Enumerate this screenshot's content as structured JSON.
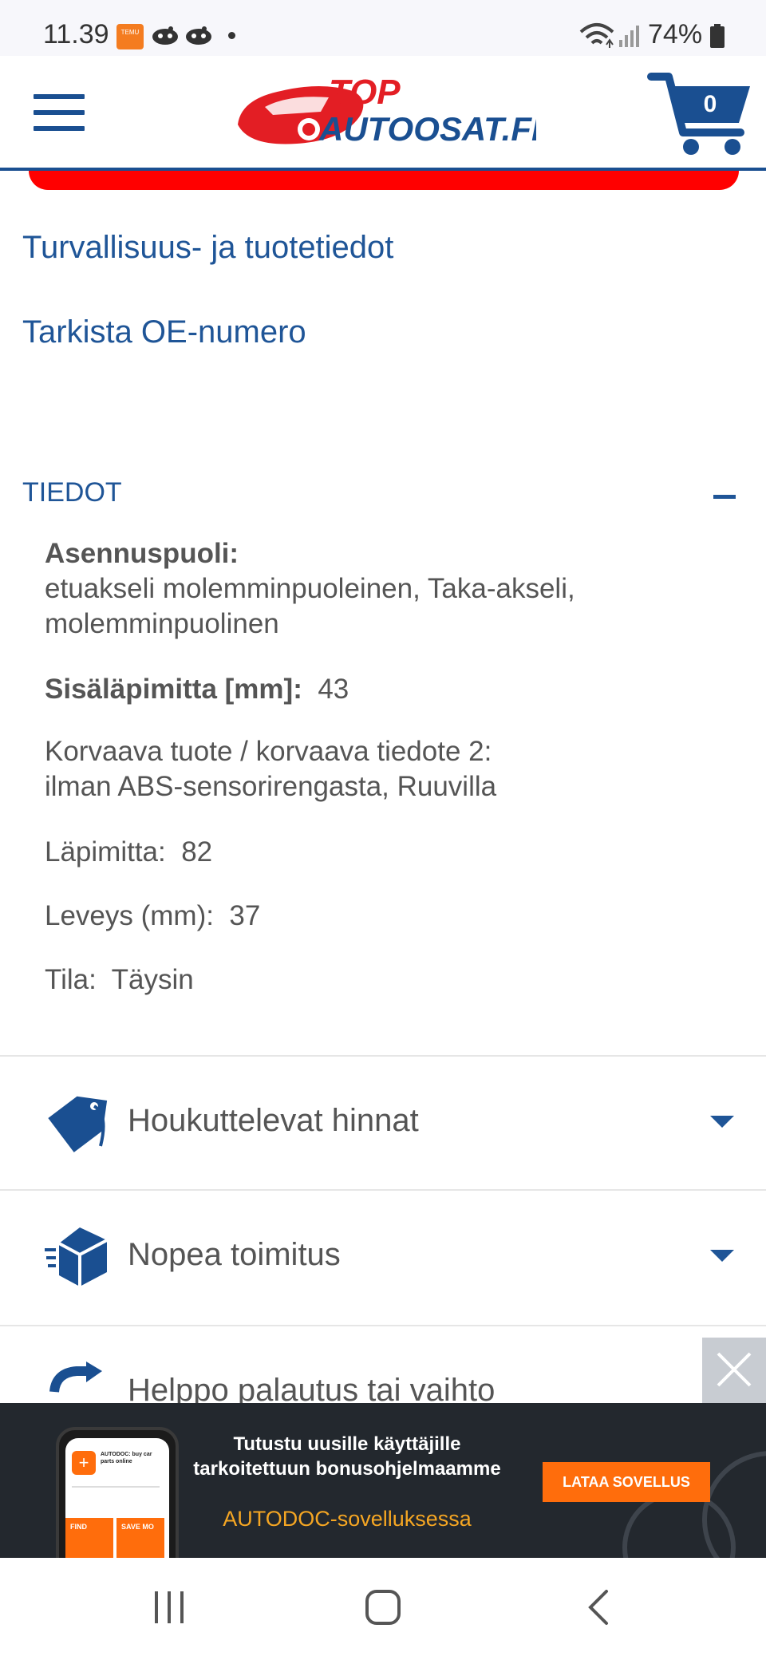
{
  "status_bar": {
    "time": "11.39",
    "temu_label": "TEMU",
    "battery": "74%"
  },
  "header": {
    "logo_line1": "TOP",
    "logo_line2": "AUTOOSAT.FI",
    "cart_count": "0"
  },
  "links": {
    "safety": "Turvallisuus- ja tuotetiedot",
    "oe_check": "Tarkista OE-numero"
  },
  "details": {
    "title": "TIEDOT",
    "specs": [
      {
        "label": "Asennuspuoli:",
        "value": "etuakseli molemminpuoleinen, Taka-akseli, molemminpuolinen"
      },
      {
        "label": "Sisäläpimitta [mm]:",
        "value": "43"
      },
      {
        "label": "Korvaava tuote / korvaava tiedote 2:",
        "value": "ilman ABS-sensorirengasta, Ruuvilla"
      },
      {
        "label": "Läpimitta:",
        "value": "82"
      },
      {
        "label": "Leveys (mm):",
        "value": "37"
      },
      {
        "label": "Tila:",
        "value": "Täysin"
      }
    ]
  },
  "features": [
    {
      "label": "Houkuttelevat hinnat",
      "icon": "price-tag-icon"
    },
    {
      "label": "Nopea toimitus",
      "icon": "fast-delivery-box-icon"
    },
    {
      "label": "Helppo palautus tai vaihto",
      "icon": "refresh-arrows-icon"
    }
  ],
  "banner": {
    "headline": "Tutustu uusille käyttäjille tarkoitettuun bonusohjelmaamme",
    "subline": "AUTODOC-sovelluksessa",
    "cta": "LATAA SOVELLUS",
    "phone_app_title": "AUTODOC: buy car parts online",
    "phone_tile_1": "FIND",
    "phone_tile_2": "SAVE MO"
  },
  "colors": {
    "brand_blue": "#1f5597",
    "accent_red": "#ff0000",
    "cta_orange": "#ff6d0c"
  }
}
